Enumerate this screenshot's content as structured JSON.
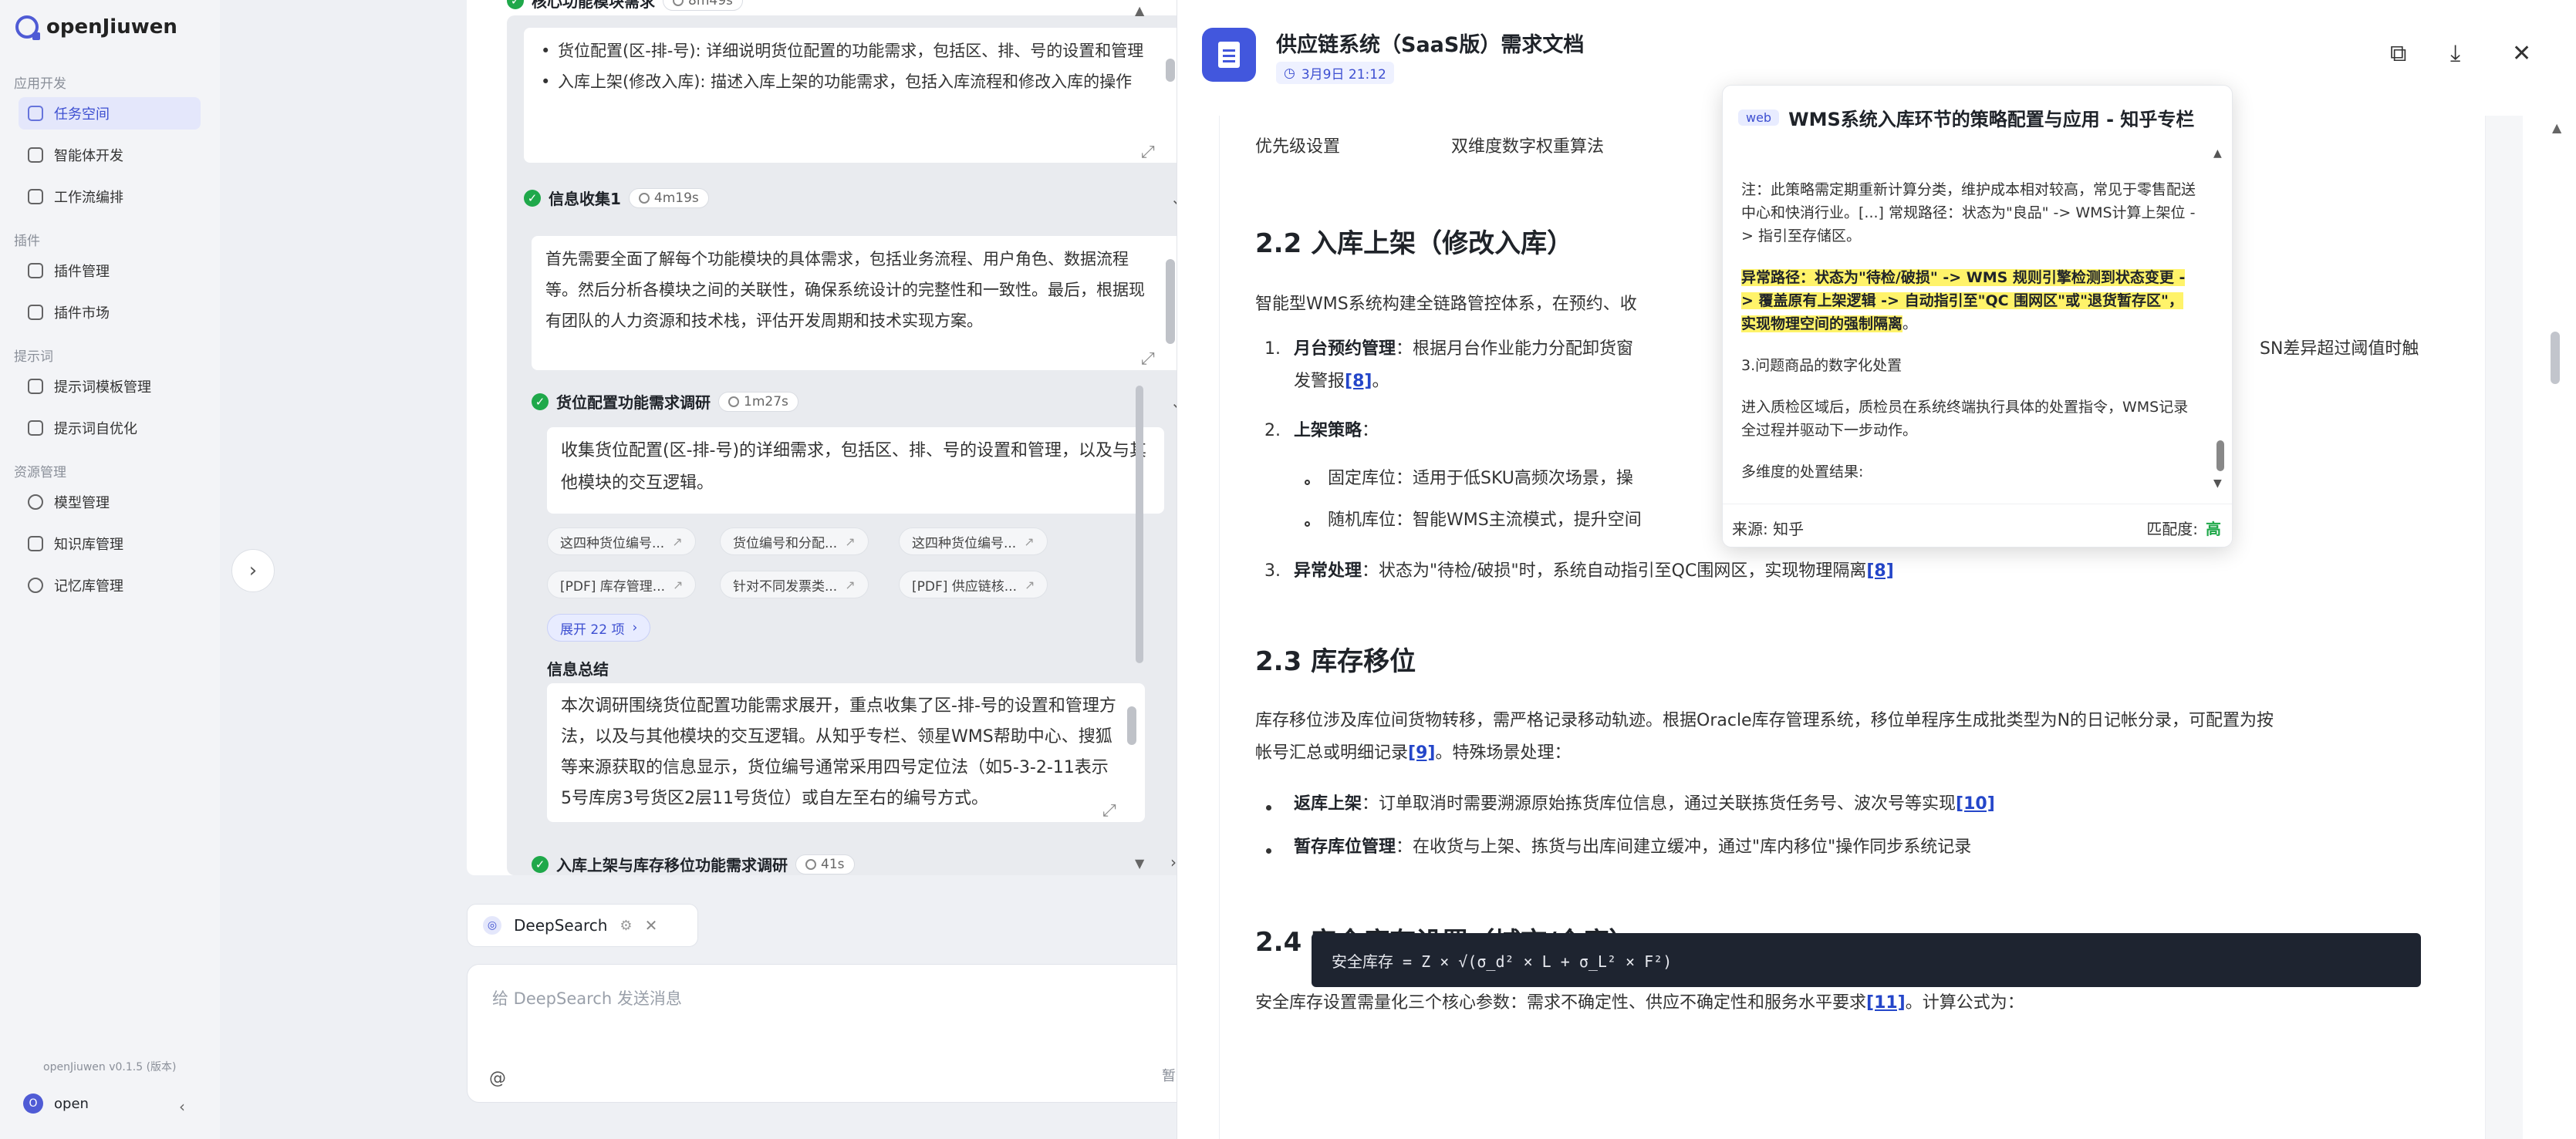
{
  "nav": {
    "brand": "openJiuwen",
    "sections": [
      {
        "title": "应用开发",
        "items": [
          "任务空间",
          "智能体开发",
          "工作流编排"
        ]
      },
      {
        "title": "插件",
        "items": [
          "插件管理",
          "插件市场"
        ]
      },
      {
        "title": "提示词",
        "items": [
          "提示词模板管理",
          "提示词自优化"
        ]
      },
      {
        "title": "资源管理",
        "items": [
          "模型管理",
          "知识库管理",
          "记忆库管理"
        ]
      }
    ],
    "version": "openJiuwen v0.1.5 (版本)",
    "user": {
      "initial": "O",
      "name": "open"
    }
  },
  "task": {
    "top_step": {
      "title": "核心功能模块需求",
      "duration": "8m49s"
    },
    "top_card": [
      "货位配置(区-排-号): 详细说明货位配置的功能需求，包括区、排、号的设置和管理",
      "入库上架(修改入库): 描述入库上架的功能需求，包括入库流程和修改入库的操作"
    ],
    "info_step": {
      "title": "信息收集1",
      "duration": "4m19s"
    },
    "info_card": "首先需要全面了解每个功能模块的具体需求，包括业务流程、用户角色、数据流程等。然后分析各模块之间的关联性，确保系统设计的完整性和一致性。最后，根据现有团队的人力资源和技术栈，评估开发周期和技术实现方案。",
    "sub_step": {
      "title": "货位配置功能需求调研",
      "duration": "1m27s"
    },
    "sub_card": "收集货位配置(区-排-号)的详细需求，包括区、排、号的设置和管理，以及与其他模块的交互逻辑。",
    "chips": [
      "这四种货位编号...",
      "货位编号和分配...",
      "这四种货位编号...",
      "[PDF] 库存管理...",
      "针对不同发票类...",
      "[PDF] 供应链核..."
    ],
    "expand_more": "展开 22 项",
    "summary_label": "信息总结",
    "summary_text": "本次调研围绕货位配置功能需求展开，重点收集了区-排-号的设置和管理方法，以及与其他模块的交互逻辑。从知乎专栏、领星WMS帮助中心、搜狐等来源获取的信息显示，货位编号通常采用四号定位法（如5-3-2-11表示5号库房3号货区2层11号货位）或自左至右的编号方式。",
    "next_step": {
      "title": "入库上架与库存移位功能需求调研",
      "duration": "41s"
    }
  },
  "composer": {
    "tab_label": "DeepSearch",
    "placeholder": "给 DeepSearch 发送消息",
    "at": "@",
    "model_label": "暂无模型"
  },
  "doc": {
    "title": "供应链系统（SaaS版）需求文档",
    "date": "3月9日 21:12",
    "table_row": [
      "优先级设置",
      "双维度数字权重算法"
    ],
    "h_22": "2.2 入库上架（修改入库）",
    "intro_22": "智能型WMS系统构建全链路管控体系，在预约、收",
    "item1_label": "月台预约管理",
    "item1_text": "：根据月台作业能力分配卸货窗",
    "item1_tail": "SN差异超过阈值时触",
    "item1_line2": "发警报",
    "ref8": "[8]",
    "item2_label": "上架策略",
    "item2_sub1": "固定库位：适用于低SKU高频次场景，操",
    "item2_sub2": "随机库位：智能WMS主流模式，提升空间",
    "item3_label": "异常处理",
    "item3_text": "：状态为\"待检/破损\"时，系统自动指引至QC围网区，实现物理隔离",
    "h_23": "2.3 库存移位",
    "p_23a": "库存移位涉及库位间货物转移，需严格记录移动轨迹。根据Oracle库存管理系统，移位单程序生成批类型为N的日记帐分录，可配置为按",
    "p_23b": "帐号汇总或明细记录",
    "ref9": "[9]",
    "p_23b_tail": "。特殊场景处理：",
    "b1_label": "返库上架",
    "b1_text": "：订单取消时需要溯源原始拣货库位信息，通过关联拣货任务号、波次号等实现",
    "ref10": "[10]",
    "b2_label": "暂存库位管理",
    "b2_text": "：在收货与上架、拣货与出库间建立缓冲，通过\"库内移位\"操作同步系统记录",
    "h_24": "2.4 安全库存设置（城市/仓库）",
    "p_24": "安全库存设置需量化三个核心参数：需求不确定性、供应不确定性和服务水平要求",
    "ref11": "[11]",
    "p_24_tail": "。计算公式为：",
    "formula": "安全库存 = Z × √(σ_d² × L + σ_L² × F²)"
  },
  "popover": {
    "tag": "web",
    "title": "WMS系统入库环节的策略配置与应用 - 知乎专栏",
    "para1": "注：此策略需定期重新计算分类，维护成本相对较高，常见于零售配送中心和快消行业。[...] 常规路径：状态为\"良品\" -> WMS计算上架位 -> 指引至存储区。",
    "para2": "异常路径：状态为\"待检/破损\" -> WMS 规则引擎检测到状态变更 -> 覆盖原有上架逻辑 -> 自动指引至\"QC 围网区\"或\"退货暂存区\"，实现物理空间的强制隔离",
    "para2_tail": "。",
    "para3": "3.问题商品的数字化处置",
    "para4": "进入质检区域后，质检员在系统终端执行具体的处置指令，WMS记录全过程并驱动下一步动作。",
    "para5": "多维度的处置结果:",
    "source": "来源:   知乎",
    "match_label": "匹配度:",
    "match_level": "高"
  },
  "colors": {
    "accent": "#4257dd",
    "success": "#1fa84a",
    "highlight": "#fff36a",
    "link": "#2446c9"
  }
}
